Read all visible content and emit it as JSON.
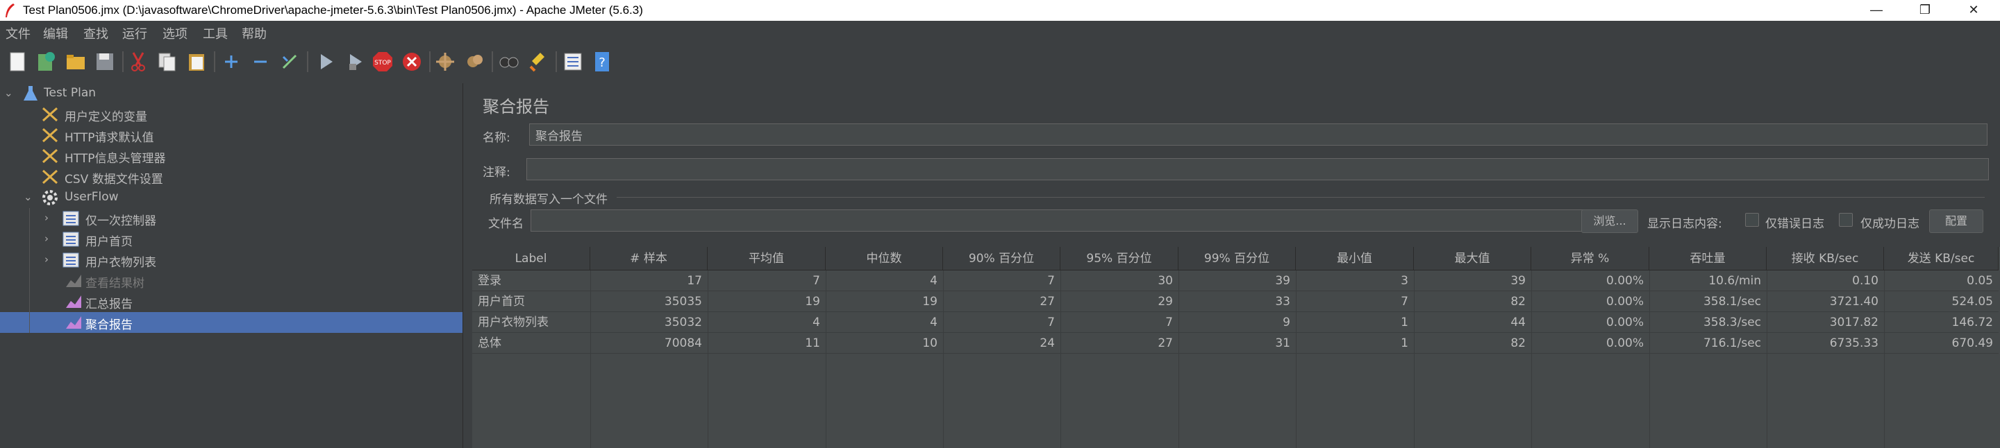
{
  "window": {
    "title": "Test Plan0506.jmx (D:\\javasoftware\\ChromeDriver\\apache-jmeter-5.6.3\\bin\\Test Plan0506.jmx) - Apache JMeter (5.6.3)",
    "minimize": "—",
    "maximize": "❐",
    "close": "✕"
  },
  "menu": [
    "文件",
    "编辑",
    "查找",
    "运行",
    "选项",
    "工具",
    "帮助"
  ],
  "toolbar": {
    "icons": [
      "new-icon",
      "templates-icon",
      "open-icon",
      "save-icon",
      "cut-icon",
      "copy-icon",
      "paste-icon",
      "expand-icon",
      "collapse-icon",
      "toggle-icon",
      "start-icon",
      "start-no-pause-icon",
      "stop-icon",
      "shutdown-icon",
      "clear-icon",
      "clear-all-icon",
      "search-icon",
      "reset-search-icon",
      "function-helper-icon",
      "help-icon"
    ],
    "stop_label": "STOP"
  },
  "tree": {
    "items": [
      {
        "label": "Test Plan",
        "icon": "flask-icon"
      },
      {
        "label": "用户定义的变量",
        "icon": "wrench-icon"
      },
      {
        "label": "HTTP请求默认值",
        "icon": "wrench-icon"
      },
      {
        "label": "HTTP信息头管理器",
        "icon": "wrench-icon"
      },
      {
        "label": "CSV 数据文件设置",
        "icon": "wrench-icon"
      },
      {
        "label": "UserFlow",
        "icon": "gear-icon"
      },
      {
        "label": "仅一次控制器",
        "icon": "controller-icon"
      },
      {
        "label": "用户首页",
        "icon": "controller-icon"
      },
      {
        "label": "用户衣物列表",
        "icon": "controller-icon"
      },
      {
        "label": "查看结果树",
        "icon": "chart-icon"
      },
      {
        "label": "汇总报告",
        "icon": "chart-icon"
      },
      {
        "label": "聚合报告",
        "icon": "chart-icon"
      }
    ]
  },
  "panel": {
    "title": "聚合报告",
    "name_label": "名称:",
    "name_value": "聚合报告",
    "comment_label": "注释:",
    "comment_value": "",
    "file_group_label": "所有数据写入一个文件",
    "filename_label": "文件名",
    "filename_value": "",
    "browse_button": "浏览...",
    "log_content_label": "显示日志内容:",
    "errors_only_label": "仅错误日志",
    "success_only_label": "仅成功日志",
    "configure_button": "配置"
  },
  "table": {
    "headers": [
      "Label",
      "# 样本",
      "平均值",
      "中位数",
      "90% 百分位",
      "95% 百分位",
      "99% 百分位",
      "最小值",
      "最大值",
      "异常 %",
      "吞吐量",
      "接收 KB/sec",
      "发送 KB/sec"
    ],
    "rows": [
      [
        "登录",
        "17",
        "7",
        "4",
        "7",
        "30",
        "39",
        "3",
        "39",
        "0.00%",
        "10.6/min",
        "0.10",
        "0.05"
      ],
      [
        "用户首页",
        "35035",
        "19",
        "19",
        "27",
        "29",
        "33",
        "7",
        "82",
        "0.00%",
        "358.1/sec",
        "3721.40",
        "524.05"
      ],
      [
        "用户衣物列表",
        "35032",
        "4",
        "4",
        "7",
        "7",
        "9",
        "1",
        "44",
        "0.00%",
        "358.3/sec",
        "3017.82",
        "146.72"
      ],
      [
        "总体",
        "70084",
        "11",
        "10",
        "24",
        "27",
        "31",
        "1",
        "82",
        "0.00%",
        "716.1/sec",
        "6735.33",
        "670.49"
      ]
    ]
  }
}
